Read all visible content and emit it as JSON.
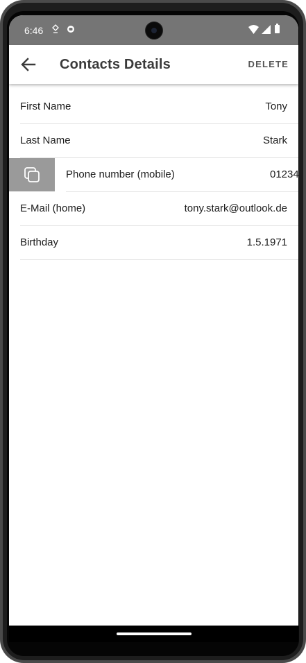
{
  "status_bar": {
    "time": "6:46"
  },
  "app_bar": {
    "title": "Contacts Details",
    "delete_label": "DELETE"
  },
  "rows": [
    {
      "label": "First Name",
      "value": "Tony"
    },
    {
      "label": "Last Name",
      "value": "Stark"
    },
    {
      "label": "Phone number (mobile)",
      "value": "01234"
    },
    {
      "label": "E-Mail (home)",
      "value": "tony.stark@outlook.de"
    },
    {
      "label": "Birthday",
      "value": "1.5.1971"
    }
  ],
  "icons": {
    "back": "arrow-back-icon",
    "copy": "copy-icon"
  },
  "colors": {
    "status_bar": "#757575",
    "swipe_action": "#9a9a9a"
  }
}
